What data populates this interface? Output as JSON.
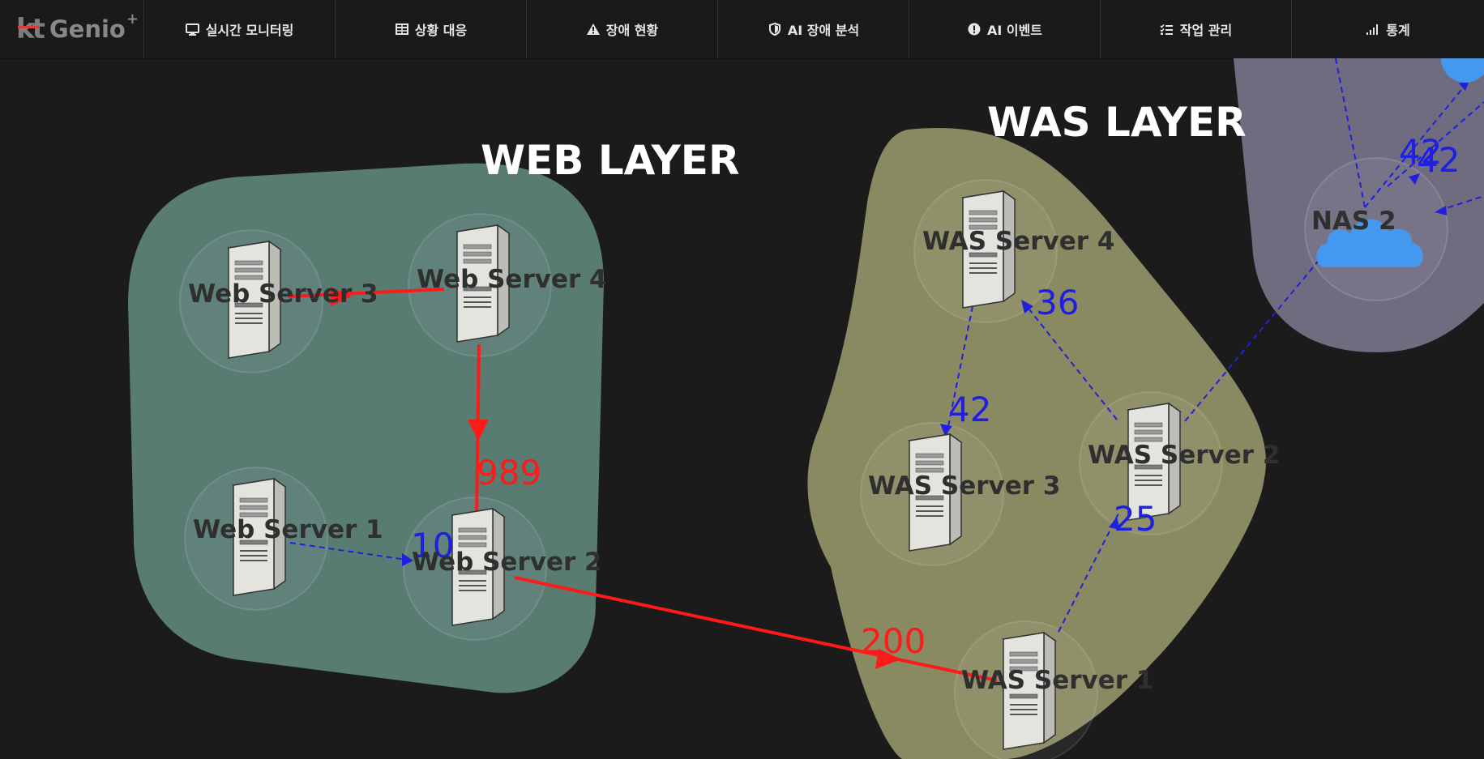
{
  "brand": {
    "logo_text": "kt Genio+"
  },
  "nav": {
    "items": [
      {
        "label": "실시간 모니터링",
        "icon": "monitor-icon"
      },
      {
        "label": "상황 대응",
        "icon": "table-icon"
      },
      {
        "label": "장애 현황",
        "icon": "warning-icon"
      },
      {
        "label": "AI 장애 분석",
        "icon": "shield-icon"
      },
      {
        "label": "AI 이벤트",
        "icon": "exclamation-icon"
      },
      {
        "label": "작업 관리",
        "icon": "checklist-icon"
      },
      {
        "label": "통계",
        "icon": "signal-bars-icon"
      }
    ]
  },
  "colors": {
    "web_layer_fill": "#587b72",
    "was_layer_fill": "#8a8a62",
    "nas_layer_fill": "#6f6c80",
    "alert_link": "#ff1a1a",
    "normal_link": "#1f1fe0",
    "cloud": "#4499ee"
  },
  "layers": {
    "web": {
      "title": "WEB LAYER"
    },
    "was": {
      "title": "WAS LAYER"
    }
  },
  "nodes": {
    "web_server_3": {
      "label": "Web Server 3"
    },
    "web_server_4": {
      "label": "Web Server 4"
    },
    "web_server_1": {
      "label": "Web Server 1"
    },
    "web_server_2": {
      "label": "Web Server 2"
    },
    "was_server_4": {
      "label": "WAS Server 4"
    },
    "was_server_3": {
      "label": "WAS Server 3"
    },
    "was_server_2": {
      "label": "WAS Server 2"
    },
    "was_server_1": {
      "label": "WAS Server 1"
    },
    "nas_2": {
      "label": "NAS 2"
    }
  },
  "links": {
    "ws4_ws2": {
      "value": "989",
      "status": "alert"
    },
    "ws1_ws2": {
      "value": "10",
      "status": "normal"
    },
    "ws2_was1": {
      "value": "200",
      "status": "alert"
    },
    "was2_was4": {
      "value": "36",
      "status": "normal"
    },
    "was4_was3": {
      "value": "42",
      "status": "normal"
    },
    "was1_was2": {
      "value": "25",
      "status": "normal"
    },
    "nas_a": {
      "value": "42",
      "status": "normal"
    },
    "nas_b": {
      "value": "42",
      "status": "normal"
    }
  }
}
